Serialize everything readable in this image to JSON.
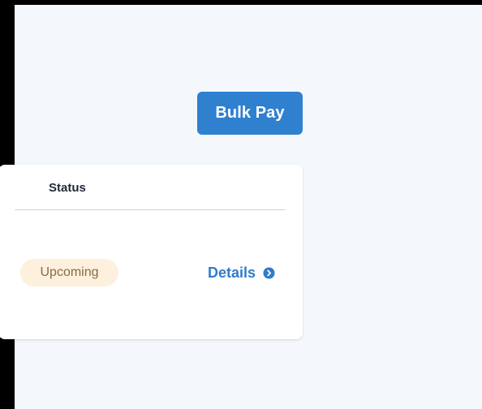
{
  "toolbar": {
    "bulk_pay_label": "Bulk Pay"
  },
  "table": {
    "columns": [
      {
        "label": "Status"
      }
    ],
    "rows": [
      {
        "status": "Upcoming",
        "action_label": "Details",
        "action_icon": "chevron-right-circle-icon"
      }
    ]
  },
  "colors": {
    "primary": "#2f80cf",
    "link": "#2f7cc8",
    "badge_bg": "#fdf0dd",
    "badge_text": "#8a6a45",
    "page_bg": "#f4f8fc"
  }
}
